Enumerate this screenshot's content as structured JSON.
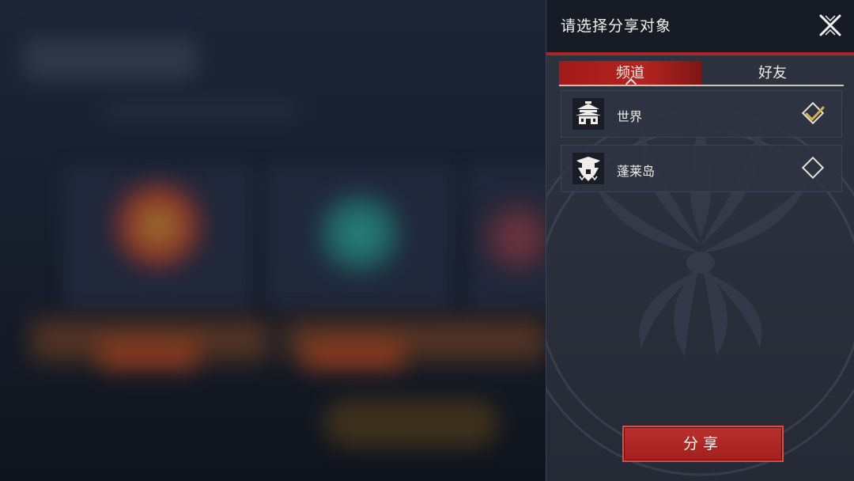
{
  "panel": {
    "title": "请选择分享对象",
    "close_icon": "close-x-icon"
  },
  "tabs": [
    {
      "label": "频道",
      "active": true
    },
    {
      "label": "好友",
      "active": false
    }
  ],
  "channels": [
    {
      "label": "世界",
      "icon": "pavilion-icon",
      "selected": true
    },
    {
      "label": "蓬莱岛",
      "icon": "island-temple-icon",
      "selected": false
    }
  ],
  "share_button": {
    "label": "分享"
  },
  "colors": {
    "accent_red": "#a8282a",
    "panel_bg": "#2a2f3b",
    "header_bg": "#171b25",
    "check_gold": "#d8b04a"
  }
}
